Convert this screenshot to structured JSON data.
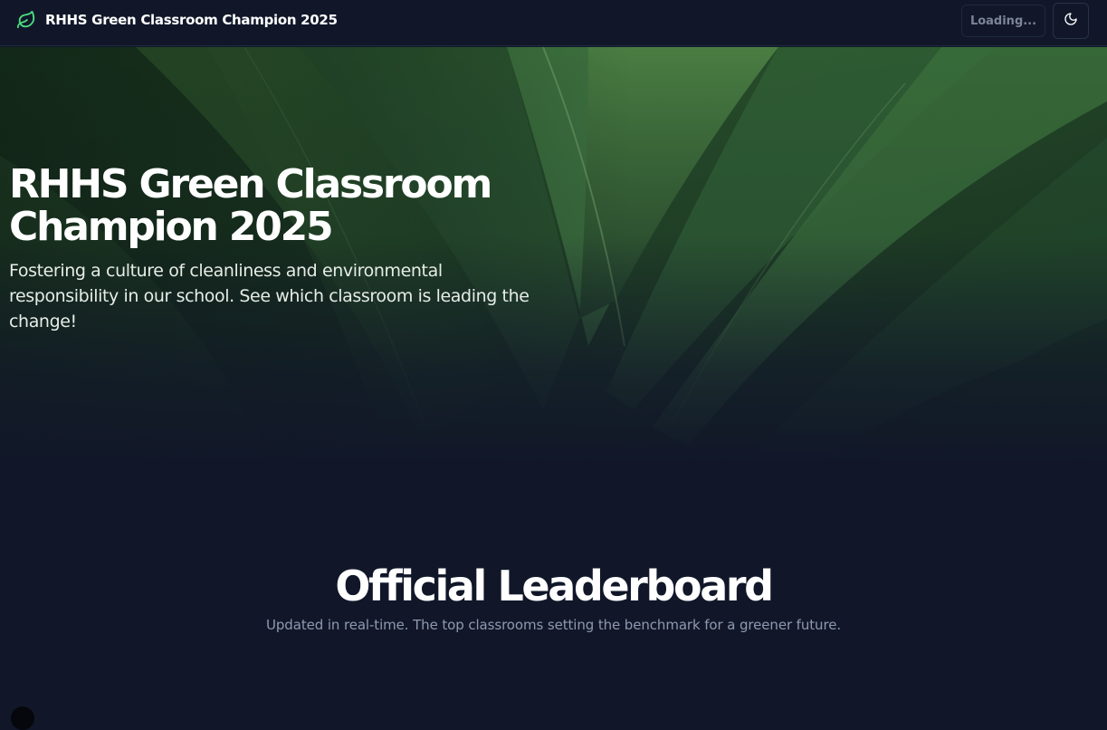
{
  "header": {
    "brand_title": "RHHS Green Classroom Champion 2025",
    "logo_icon": "leaf-icon",
    "loading_label": "Loading...",
    "theme_icon": "moon-icon"
  },
  "hero": {
    "title": "RHHS Green Classroom Champion 2025",
    "subtitle": "Fostering a culture of cleanliness and environmental responsibility in our school. See which classroom is leading the change!"
  },
  "leaderboard": {
    "title": "Official Leaderboard",
    "subtitle": "Updated in real-time. The top classrooms setting the benchmark for a greener future."
  },
  "colors": {
    "background": "#111729",
    "accent": "#4ade80",
    "muted_text": "#8e99b0"
  }
}
